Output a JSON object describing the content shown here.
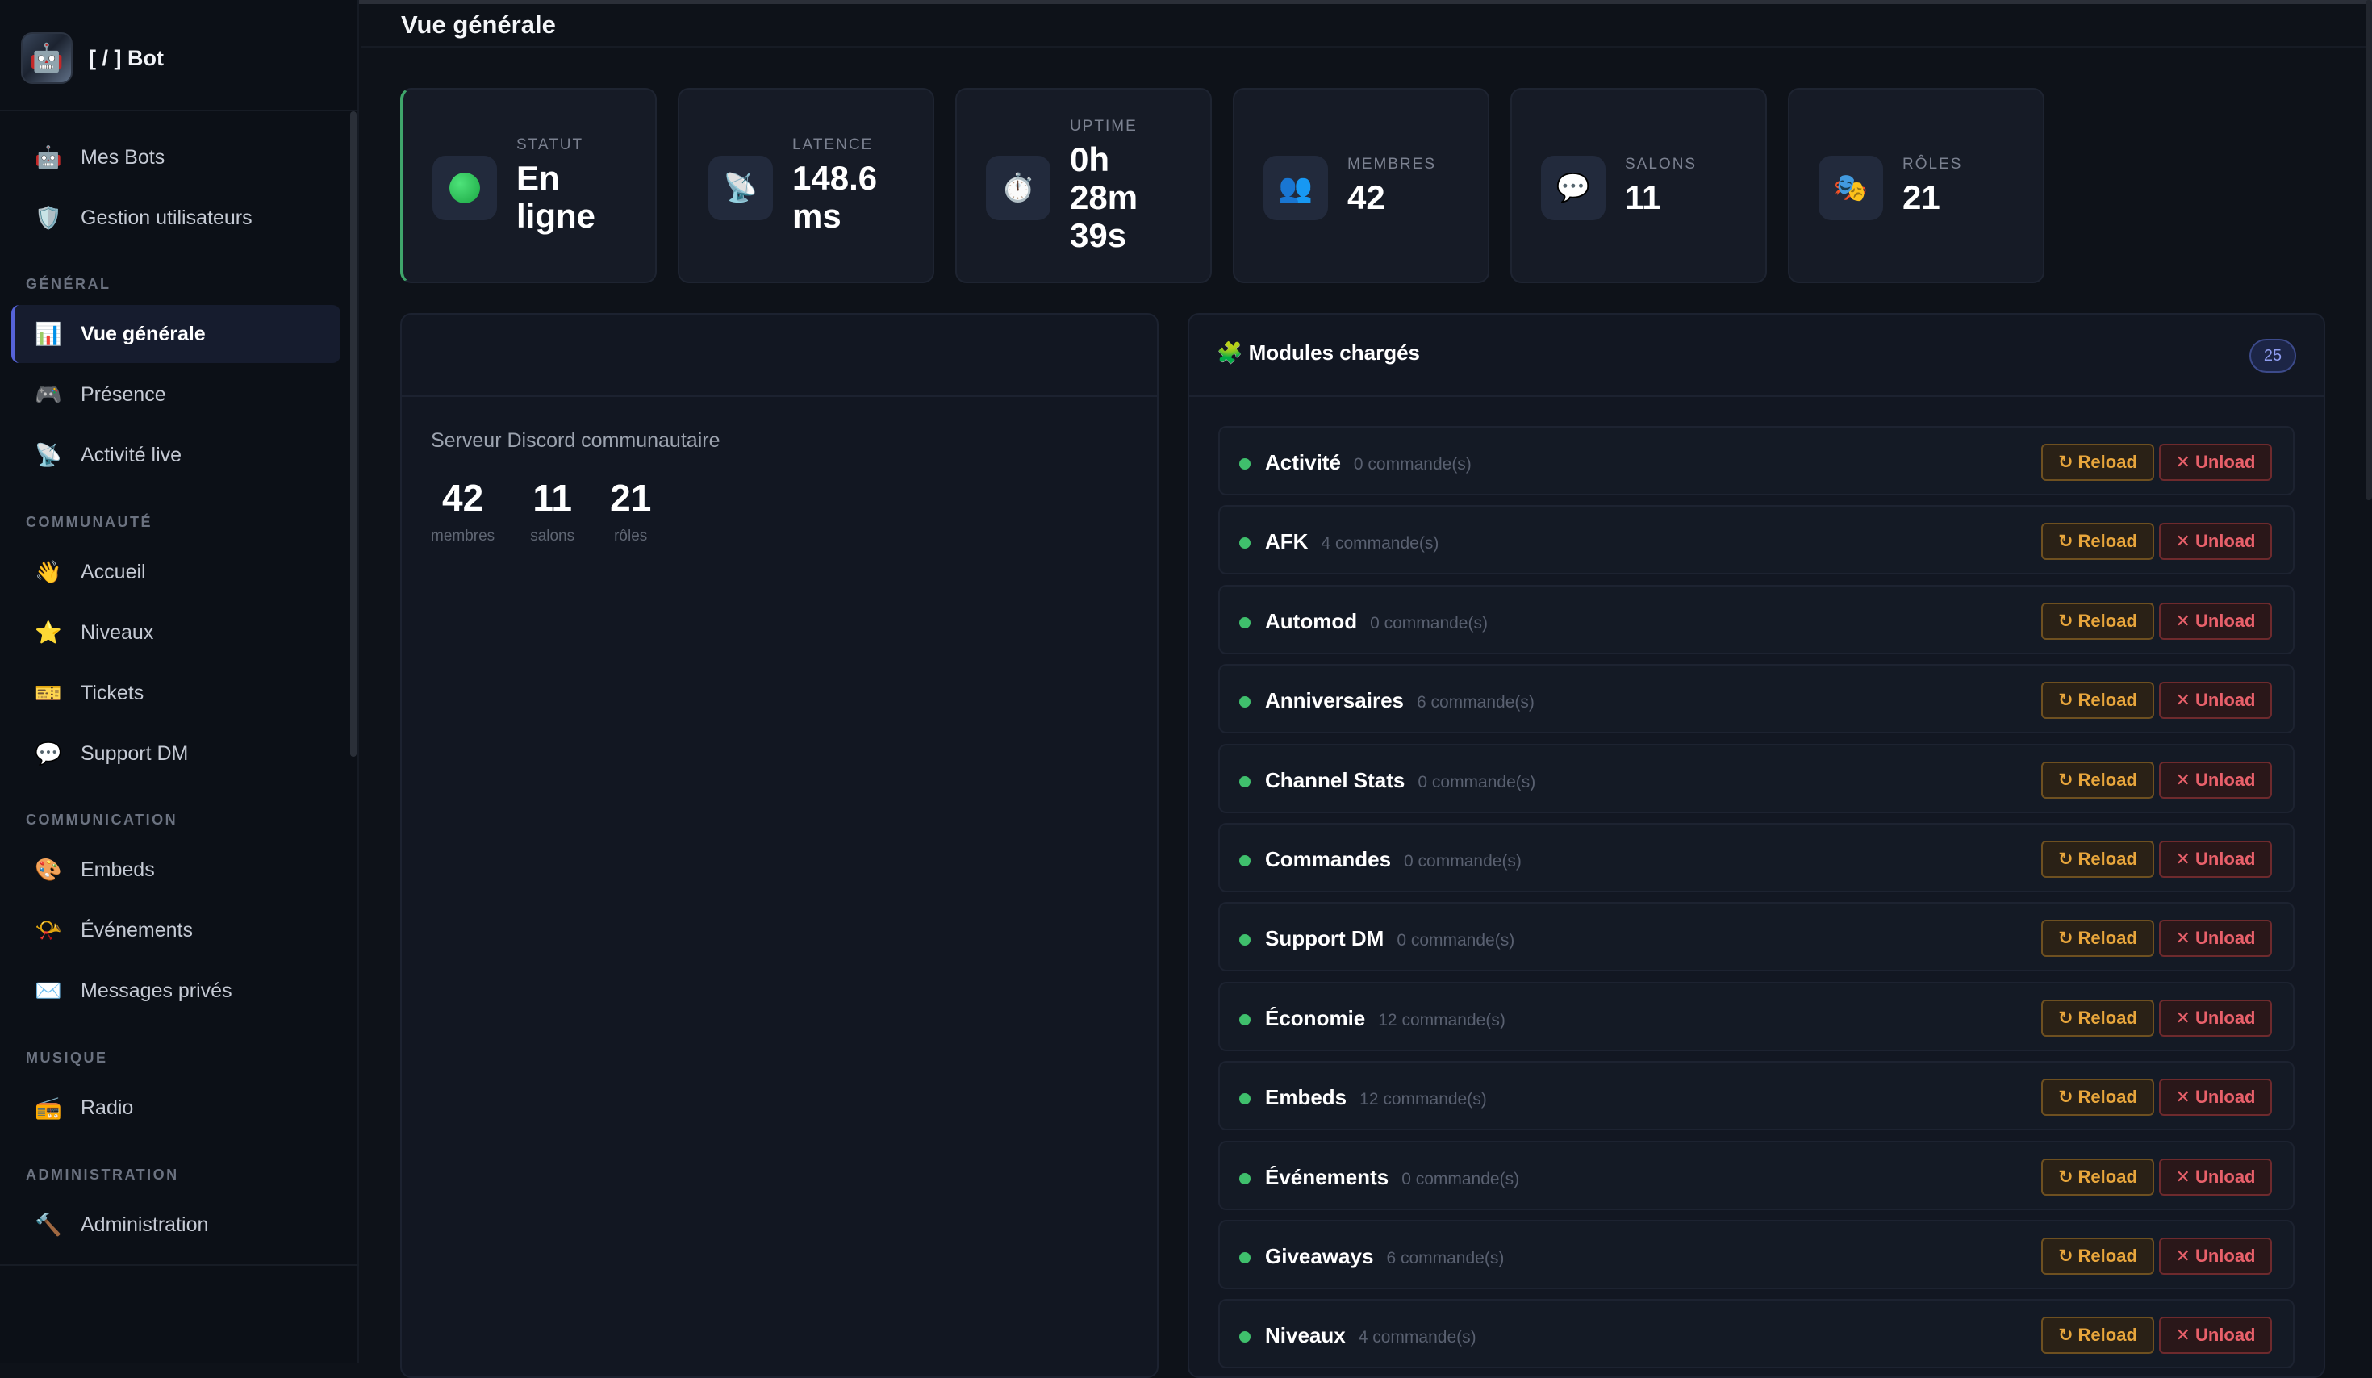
{
  "brand": {
    "name": "[ / ] Bot",
    "logo_icon": "🤖"
  },
  "sidebar": {
    "top_items": [
      {
        "icon": "🤖",
        "label": "Mes Bots"
      },
      {
        "icon": "🛡️",
        "label": "Gestion utilisateurs"
      }
    ],
    "sections": [
      {
        "title": "GÉNÉRAL",
        "items": [
          {
            "icon": "📊",
            "label": "Vue générale",
            "active": true
          },
          {
            "icon": "🎮",
            "label": "Présence"
          },
          {
            "icon": "📡",
            "label": "Activité live"
          }
        ]
      },
      {
        "title": "COMMUNAUTÉ",
        "items": [
          {
            "icon": "👋",
            "label": "Accueil"
          },
          {
            "icon": "⭐",
            "label": "Niveaux"
          },
          {
            "icon": "🎫",
            "label": "Tickets"
          },
          {
            "icon": "💬",
            "label": "Support DM"
          }
        ]
      },
      {
        "title": "COMMUNICATION",
        "items": [
          {
            "icon": "🎨",
            "label": "Embeds"
          },
          {
            "icon": "📯",
            "label": "Événements"
          },
          {
            "icon": "✉️",
            "label": "Messages privés"
          }
        ]
      },
      {
        "title": "MUSIQUE",
        "items": [
          {
            "icon": "📻",
            "label": "Radio"
          }
        ]
      },
      {
        "title": "ADMINISTRATION",
        "items": [
          {
            "icon": "🔨",
            "label": "Administration"
          }
        ]
      }
    ]
  },
  "header": {
    "title": "Vue générale"
  },
  "stats": [
    {
      "icon": "status-dot",
      "label": "STATUT",
      "value": "En\nligne"
    },
    {
      "icon": "📡",
      "label": "LATENCE",
      "value": "148.6\nms"
    },
    {
      "icon": "⏱️",
      "label": "UPTIME",
      "value": "0h\n28m\n39s"
    },
    {
      "icon": "👥",
      "label": "MEMBRES",
      "value": "42"
    },
    {
      "icon": "💬",
      "label": "SALONS",
      "value": "11"
    },
    {
      "icon": "🎭",
      "label": "RÔLES",
      "value": "21"
    }
  ],
  "server": {
    "description": "Serveur Discord communautaire",
    "stats": [
      {
        "value": "42",
        "caption": "membres"
      },
      {
        "value": "11",
        "caption": "salons"
      },
      {
        "value": "21",
        "caption": "rôles"
      }
    ]
  },
  "modules": {
    "title": "🧩 Modules chargés",
    "count": "25",
    "reload_label": "Reload",
    "unload_label": "Unload",
    "reload_icon": "↻",
    "unload_icon": "✕",
    "items": [
      {
        "name": "Activité",
        "commands": "0 commande(s)"
      },
      {
        "name": "AFK",
        "commands": "4 commande(s)"
      },
      {
        "name": "Automod",
        "commands": "0 commande(s)"
      },
      {
        "name": "Anniversaires",
        "commands": "6 commande(s)"
      },
      {
        "name": "Channel Stats",
        "commands": "0 commande(s)"
      },
      {
        "name": "Commandes",
        "commands": "0 commande(s)"
      },
      {
        "name": "Support DM",
        "commands": "0 commande(s)"
      },
      {
        "name": "Économie",
        "commands": "12 commande(s)"
      },
      {
        "name": "Embeds",
        "commands": "12 commande(s)"
      },
      {
        "name": "Événements",
        "commands": "0 commande(s)"
      },
      {
        "name": "Giveaways",
        "commands": "6 commande(s)"
      },
      {
        "name": "Niveaux",
        "commands": "4 commande(s)"
      }
    ]
  }
}
